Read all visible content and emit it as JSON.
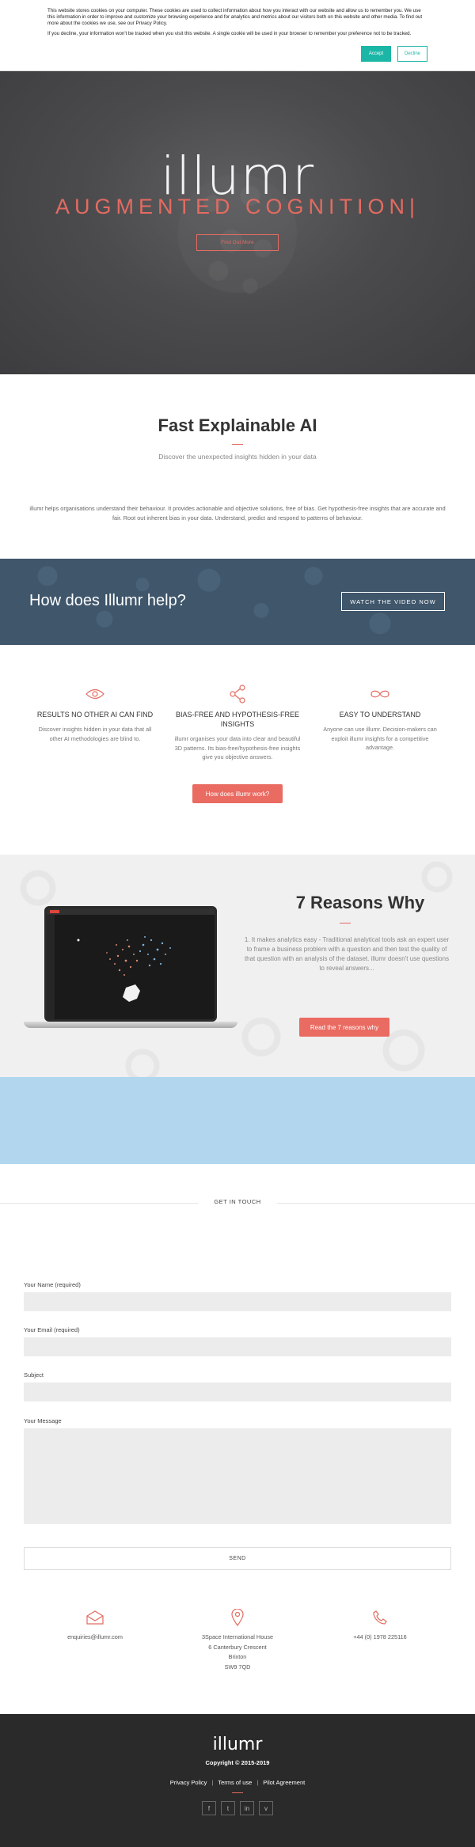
{
  "cookie": {
    "text1": "This website stores cookies on your computer. These cookies are used to collect information about how you interact with our website and allow us to remember you. We use this information in order to improve and customize your browsing experience and for analytics and metrics about our visitors both on this website and other media. To find out more about the cookies we use, see our Privacy Policy.",
    "text2": "If you decline, your information won't be tracked when you visit this website. A single cookie will be used in your browser to remember your preference not to be tracked.",
    "accept": "Accept",
    "decline": "Decline"
  },
  "hero": {
    "logo": "illumr",
    "tagline": "AUGMENTED COGNITION|",
    "button": "Find Out More"
  },
  "intro": {
    "title": "Fast Explainable AI",
    "subtitle": "Discover the unexpected insights hidden in your data",
    "body": "illumr helps organisations understand their behaviour. It provides actionable and objective solutions, free of bias. Get hypothesis-free insights that are accurate and fair. Root out inherent bias in your data. Understand, predict and respond to patterns of behaviour."
  },
  "band": {
    "title": "How does Illumr help?",
    "button": "WATCH THE VIDEO NOW"
  },
  "features": {
    "items": [
      {
        "icon": "eye-icon",
        "title": "RESULTS NO OTHER AI CAN FIND",
        "text": "Discover insights hidden in your data that all other AI methodologies are blind to."
      },
      {
        "icon": "share-icon",
        "title": "BIAS-FREE AND HYPOTHESIS-FREE INSIGHTS",
        "text": "illumr organises your data into clear and beautiful 3D patterns. Its bias-free/hypothesis-free insights give you objective answers."
      },
      {
        "icon": "infinity-icon",
        "title": "EASY TO UNDERSTAND",
        "text": "Anyone can use illumr. Decision-makers can exploit illumr insights for a competitive advantage."
      }
    ],
    "button": "How does illumr work?"
  },
  "reasons": {
    "title": "7 Reasons Why",
    "text": "1. It makes analytics easy - Traditional analytical tools ask an expert user to frame a business problem with a question and then test the quality of that question with an analysis of the dataset. illumr doesn't use questions to reveal answers...",
    "button": "Read the 7 reasons why"
  },
  "contact": {
    "heading": "GET IN TOUCH",
    "name_label": "Your Name (required)",
    "email_label": "Your Email (required)",
    "subject_label": "Subject",
    "message_label": "Your Message",
    "send": "SEND",
    "email": "enquiries@illumr.com",
    "address1": "3Space International House",
    "address2": "6 Canterbury Crescent",
    "address3": "Brixton",
    "address4": "SW9 7QD",
    "phone": "+44 (0) 1978 225116"
  },
  "footer": {
    "logo": "illumr",
    "copyright": "Copyright © 2015-2019",
    "privacy": "Privacy Policy",
    "terms": "Terms of use",
    "pilot": "Pilot Agreement",
    "sep": "|",
    "social": [
      "f",
      "t",
      "in",
      "v"
    ]
  },
  "colors": {
    "accent": "#e46b61",
    "teal": "#1cb6a6",
    "band_blue": "#3f566b",
    "light_blue": "#b1d6ee",
    "footer": "#2a2a2a"
  }
}
